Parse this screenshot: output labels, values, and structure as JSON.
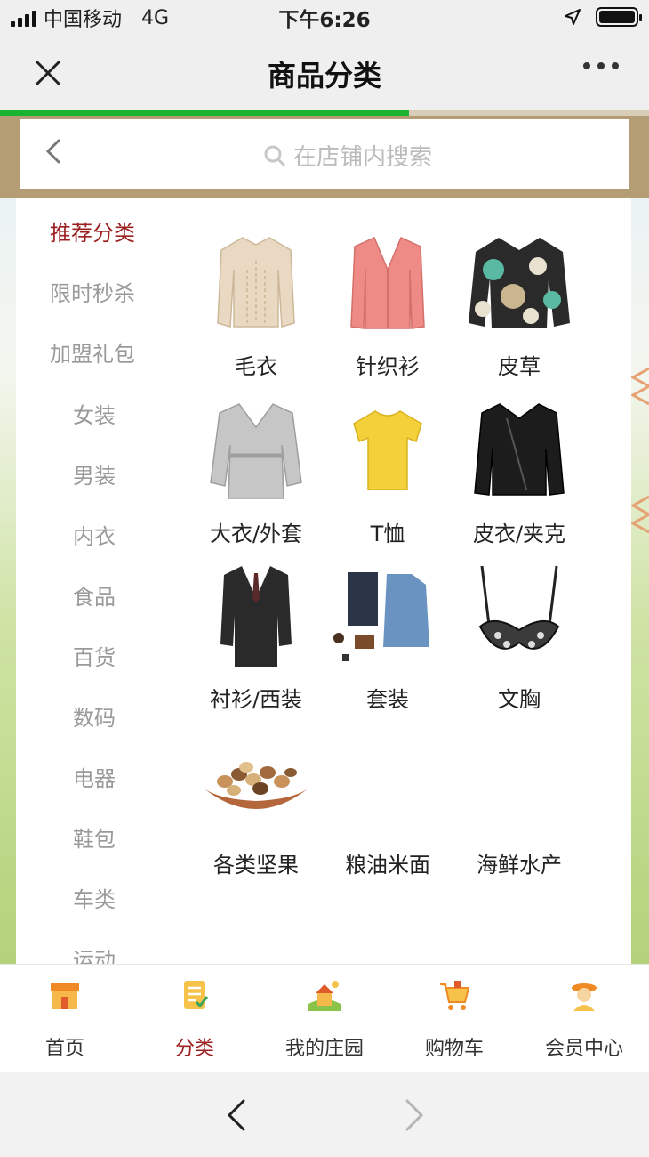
{
  "status_bar": {
    "carrier": "中国移动",
    "network": "4G",
    "time": "下午6:26"
  },
  "nav": {
    "title": "商品分类"
  },
  "progress": 0.63,
  "search": {
    "placeholder": "在店铺内搜索"
  },
  "sidebar": {
    "items": [
      "推荐分类",
      "限时秒杀",
      "加盟礼包",
      "女装",
      "男装",
      "内衣",
      "食品",
      "百货",
      "数码",
      "电器",
      "鞋包",
      "车类",
      "运动"
    ]
  },
  "categories": {
    "items": [
      {
        "label": "毛衣",
        "icon": "sweater-image"
      },
      {
        "label": "针织衫",
        "icon": "cardigan-image"
      },
      {
        "label": "皮草",
        "icon": "fur-coat-image"
      },
      {
        "label": "大衣/外套",
        "icon": "overcoat-image"
      },
      {
        "label": "T恤",
        "icon": "tshirt-image"
      },
      {
        "label": "皮衣/夹克",
        "icon": "leather-jacket-image"
      },
      {
        "label": "衬衫/西装",
        "icon": "suit-image"
      },
      {
        "label": "套装",
        "icon": "outfit-set-image"
      },
      {
        "label": "文胸",
        "icon": "bra-image"
      },
      {
        "label": "各类坚果",
        "icon": "nuts-image"
      },
      {
        "label": "粮油米面",
        "icon": ""
      },
      {
        "label": "海鲜水产",
        "icon": ""
      }
    ]
  },
  "tabbar": {
    "items": [
      {
        "label": "首页",
        "icon": "home-shop-icon"
      },
      {
        "label": "分类",
        "icon": "category-list-icon"
      },
      {
        "label": "我的庄园",
        "icon": "farm-manor-icon"
      },
      {
        "label": "购物车",
        "icon": "shopping-cart-icon"
      },
      {
        "label": "会员中心",
        "icon": "member-avatar-icon"
      }
    ]
  },
  "colors": {
    "active": "#9c1f1f",
    "progress": "#19b32f",
    "inactive_text": "#9a9a9a"
  }
}
